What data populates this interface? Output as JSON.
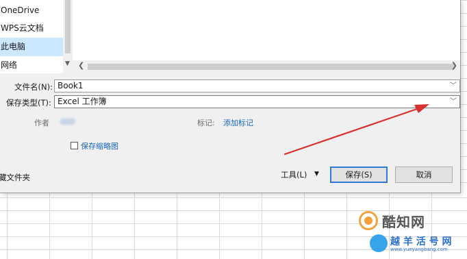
{
  "nav": {
    "items": [
      {
        "label": "OneDrive"
      },
      {
        "label": "WPS云文档"
      },
      {
        "label": "此电脑"
      },
      {
        "label": "网络"
      }
    ]
  },
  "form": {
    "filename_label": "文件名(N):",
    "filename_value": "Book1",
    "filetype_label": "保存类型(T):",
    "filetype_value": "Excel 工作簿",
    "author_label": "作者",
    "tags_label": "标记:",
    "tags_link": "添加标记",
    "thumbnail_label": "保存缩略图",
    "thumbnail_checked": false
  },
  "footer": {
    "hide_folders": "藏文件夹",
    "tools_label": "工具(L)",
    "save_label": "保存(S)",
    "cancel_label": "取消"
  },
  "watermark": {
    "text1": "酷知网",
    "text2": "越 羊 活 号 网",
    "text3": "www.yueyangbang.com"
  },
  "colors": {
    "selected_nav": "#cce8ff",
    "link": "#1a66c2",
    "annotation_arrow": "#d9302c",
    "primary_button_border": "#2d7bd6"
  }
}
